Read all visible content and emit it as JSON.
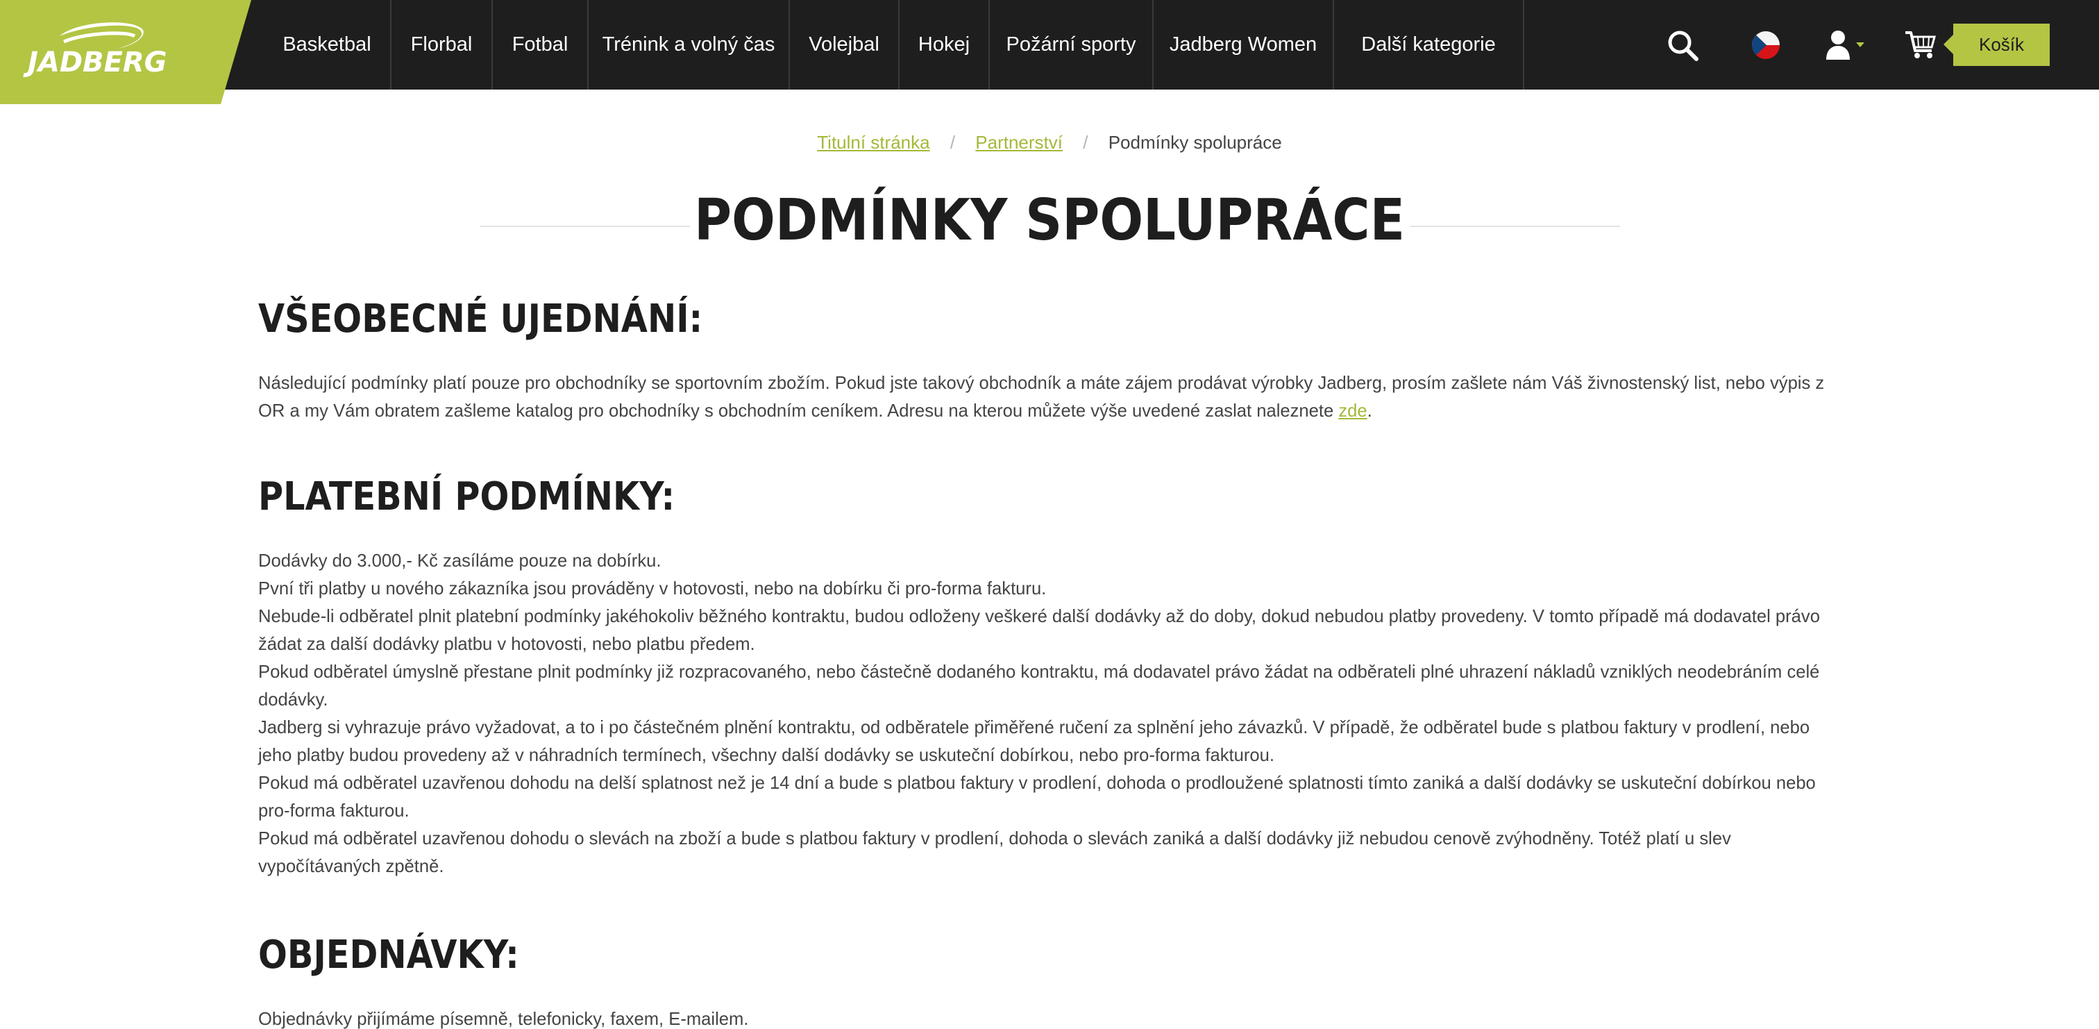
{
  "header": {
    "logo_text": "JADBERG",
    "nav": [
      "Basketbal",
      "Florbal",
      "Fotbal",
      "Trénink a volný čas",
      "Volejbal",
      "Hokej",
      "Požární sporty",
      "Jadberg Women",
      "Další kategorie"
    ],
    "cart_label": "Košík",
    "icons": [
      "search-icon",
      "czech-flag-icon",
      "user-icon",
      "chevron-down-icon",
      "cart-icon"
    ],
    "colors": {
      "accent": "#b4c544",
      "bar": "#1e1e1e"
    }
  },
  "breadcrumb": {
    "home": "Titulní stránka",
    "sep1": "/",
    "partner": "Partnerství",
    "sep2": "/",
    "current": "Podmínky spolupráce"
  },
  "page_title": "PODMÍNKY SPOLUPRÁCE",
  "sections": {
    "general": {
      "heading": "VŠEOBECNÉ UJEDNÁNÍ:",
      "text1": "Následující podmínky platí pouze pro obchodníky se sportovním zbožím. Pokud jste takový obchodník a máte zájem prodávat výrobky Jadberg, prosím zašlete nám Váš živnostenský list, nebo výpis z OR a my Vám obratem zašleme katalog pro obchodníky s obchodním ceníkem. Adresu na kterou můžete výše uvedené zaslat naleznete ",
      "link": "zde",
      "text2": "."
    },
    "payment": {
      "heading": "PLATEBNÍ PODMÍNKY:",
      "lines": [
        "Dodávky do 3.000,- Kč zasíláme pouze na dobírku.",
        "Pvní tři platby u nového zákazníka jsou prováděny v hotovosti, nebo na dobírku či pro-forma fakturu.",
        "Nebude-li odběratel plnit platební podmínky jakéhokoliv běžného kontraktu, budou odloženy veškeré další dodávky až do doby, dokud nebudou platby provedeny. V tomto případě má dodavatel právo žádat za další dodávky platbu v hotovosti, nebo platbu předem.",
        "Pokud odběratel úmyslně přestane plnit podmínky již rozpracovaného, nebo částečně dodaného kontraktu, má dodavatel právo žádat na odběrateli plné uhrazení nákladů vzniklých neodebráním celé dodávky.",
        "Jadberg si vyhrazuje právo vyžadovat, a to i po částečném plnění kontraktu, od odběratele přiměřené ručení za splnění jeho závazků. V případě, že odběratel bude s platbou faktury v prodlení, nebo jeho platby budou provedeny až v náhradních termínech, všechny další dodávky se uskuteční dobírkou, nebo pro-forma fakturou.",
        "Pokud má odběratel uzavřenou dohodu na delší splatnost než je 14 dní a bude s platbou faktury v prodlení, dohoda o prodloužené splatnosti tímto zaniká a další dodávky se uskuteční dobírkou nebo pro-forma fakturou.",
        "Pokud má odběratel uzavřenou dohodu o slevách na zboží a bude s platbou faktury v prodlení, dohoda o slevách zaniká a další dodávky již nebudou cenově zvýhodněny. Totéž platí u slev vypočítávaných zpětně."
      ]
    },
    "orders": {
      "heading": "OBJEDNÁVKY:",
      "text": "Objednávky přijímáme písemně, telefonicky, faxem, E-mailem."
    }
  }
}
